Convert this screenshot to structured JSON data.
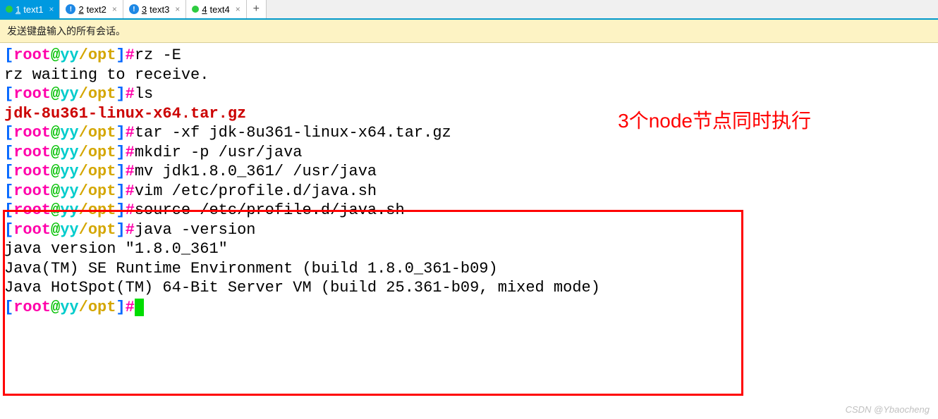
{
  "tabs": [
    {
      "num": "1",
      "label": "text1",
      "status": "green-dot",
      "active": true
    },
    {
      "num": "2",
      "label": "text2",
      "status": "info",
      "active": false
    },
    {
      "num": "3",
      "label": "text3",
      "status": "info",
      "active": false
    },
    {
      "num": "4",
      "label": "text4",
      "status": "green-dot",
      "active": false
    }
  ],
  "notice": "发送键盘输入的所有会话。",
  "prompt": {
    "open": "[",
    "user": "root",
    "at": "@",
    "host": "yy",
    "path": "/opt",
    "close": "]",
    "hash": "#"
  },
  "terminal_lines": [
    {
      "type": "cmd",
      "text": "rz -E"
    },
    {
      "type": "out",
      "text": "rz waiting to receive."
    },
    {
      "type": "cmd",
      "text": "ls"
    },
    {
      "type": "file",
      "text": "jdk-8u361-linux-x64.tar.gz"
    },
    {
      "type": "cmd",
      "text": "tar -xf jdk-8u361-linux-x64.tar.gz"
    },
    {
      "type": "cmd",
      "text": "mkdir -p /usr/java"
    },
    {
      "type": "cmd",
      "text": "mv jdk1.8.0_361/ /usr/java"
    },
    {
      "type": "cmd",
      "text": "vim /etc/profile.d/java.sh"
    },
    {
      "type": "cmd",
      "text": "source /etc/profile.d/java.sh"
    },
    {
      "type": "cmd",
      "text": "java -version"
    },
    {
      "type": "out",
      "text": "java version \"1.8.0_361\""
    },
    {
      "type": "out",
      "text": "Java(TM) SE Runtime Environment (build 1.8.0_361-b09)"
    },
    {
      "type": "out",
      "text": "Java HotSpot(TM) 64-Bit Server VM (build 25.361-b09, mixed mode)"
    },
    {
      "type": "cursor",
      "text": ""
    }
  ],
  "annotation": "3个node节点同时执行",
  "watermark": "CSDN @Ybaocheng",
  "add_tab_glyph": "+"
}
